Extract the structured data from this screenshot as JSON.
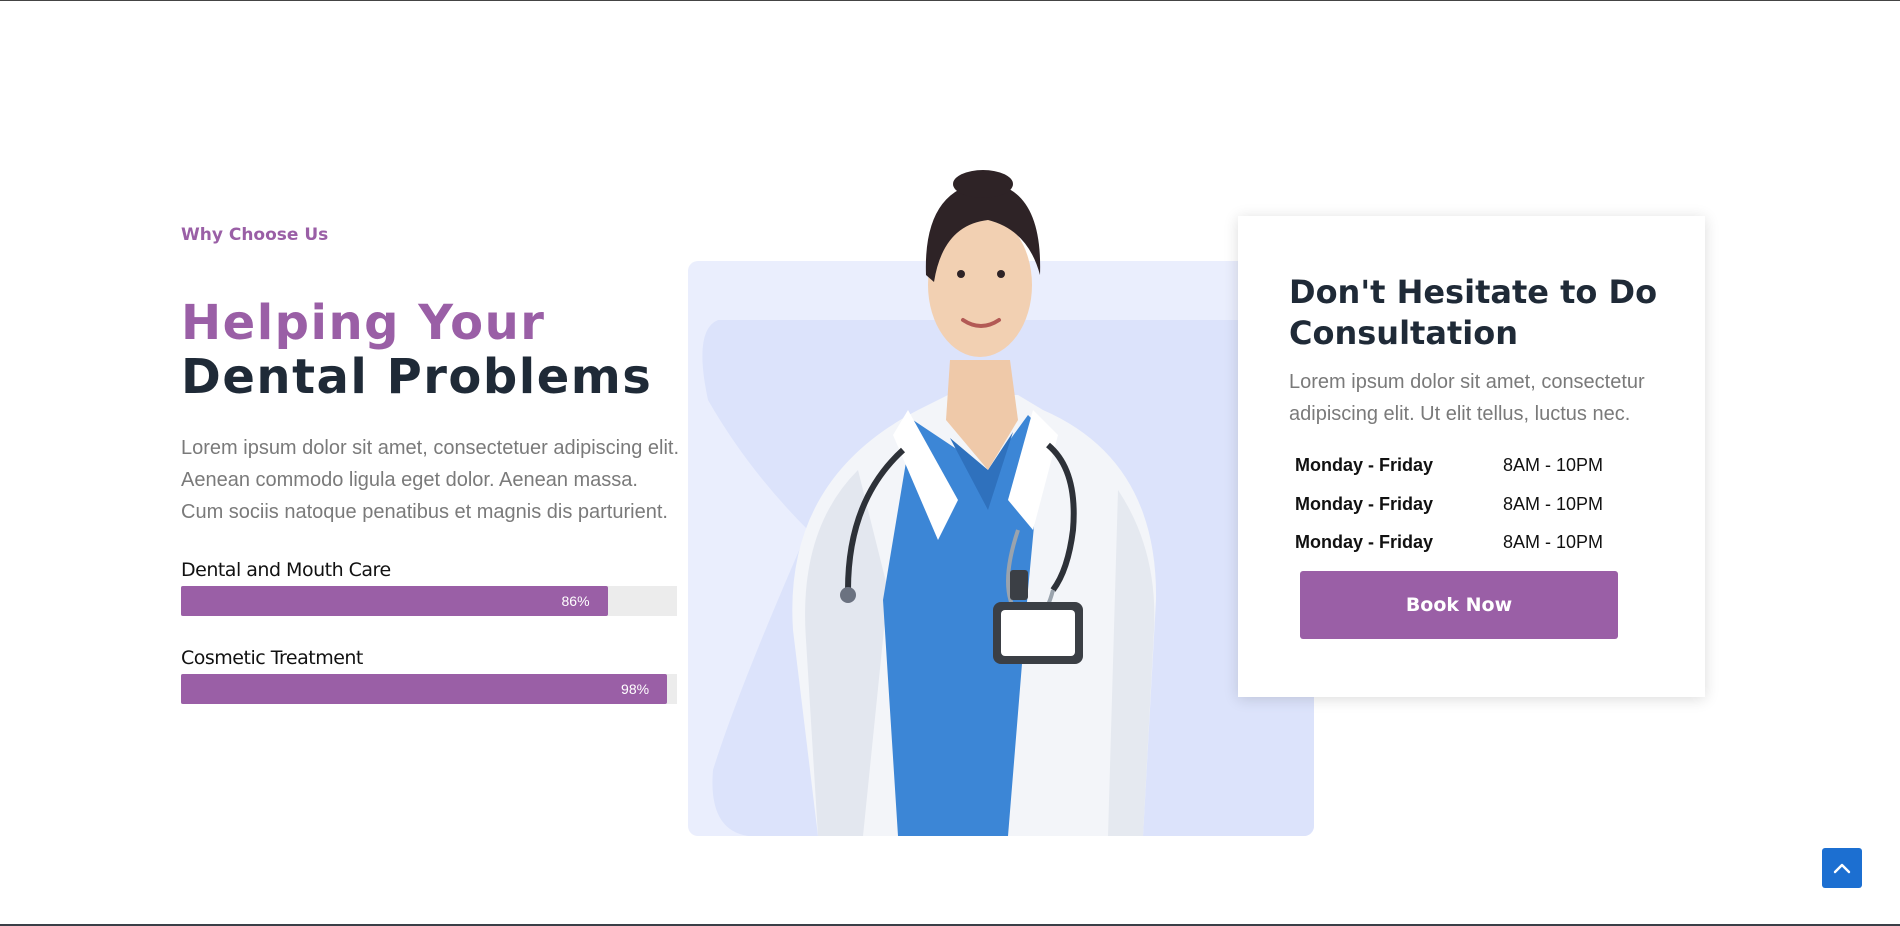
{
  "section": {
    "eyebrow": "Why Choose Us",
    "heading_line1": "Helping Your",
    "heading_line2": "Dental Problems",
    "intro": "Lorem ipsum dolor sit amet, consectetuer adipiscing elit. Aenean commodo ligula eget dolor. Aenean massa. Cum sociis natoque penatibus et magnis dis parturient."
  },
  "skills": [
    {
      "label": "Dental and Mouth Care",
      "percent_text": "86%",
      "value": 86
    },
    {
      "label": "Cosmetic Treatment",
      "percent_text": "98%",
      "value": 98
    }
  ],
  "card": {
    "title": "Don't Hesitate to Do Consultation",
    "text": "Lorem ipsum dolor sit amet, consectetur adipiscing elit. Ut elit tellus, luctus nec.",
    "hours": [
      {
        "day": "Monday - Friday",
        "time": "8AM - 10PM"
      },
      {
        "day": "Monday - Friday",
        "time": "8AM - 10PM"
      },
      {
        "day": "Monday - Friday",
        "time": "8AM - 10PM"
      }
    ],
    "button_label": "Book Now"
  },
  "icons": {
    "scroll_top": "chevron-up-icon",
    "photo": "doctor-photo"
  },
  "colors": {
    "accent": "#9a5fa6",
    "heading_dark": "#1f2a37",
    "body_text": "#7a7a7a",
    "photo_backdrop": "#dfe5fb",
    "scroll_button": "#1c6fd1"
  }
}
